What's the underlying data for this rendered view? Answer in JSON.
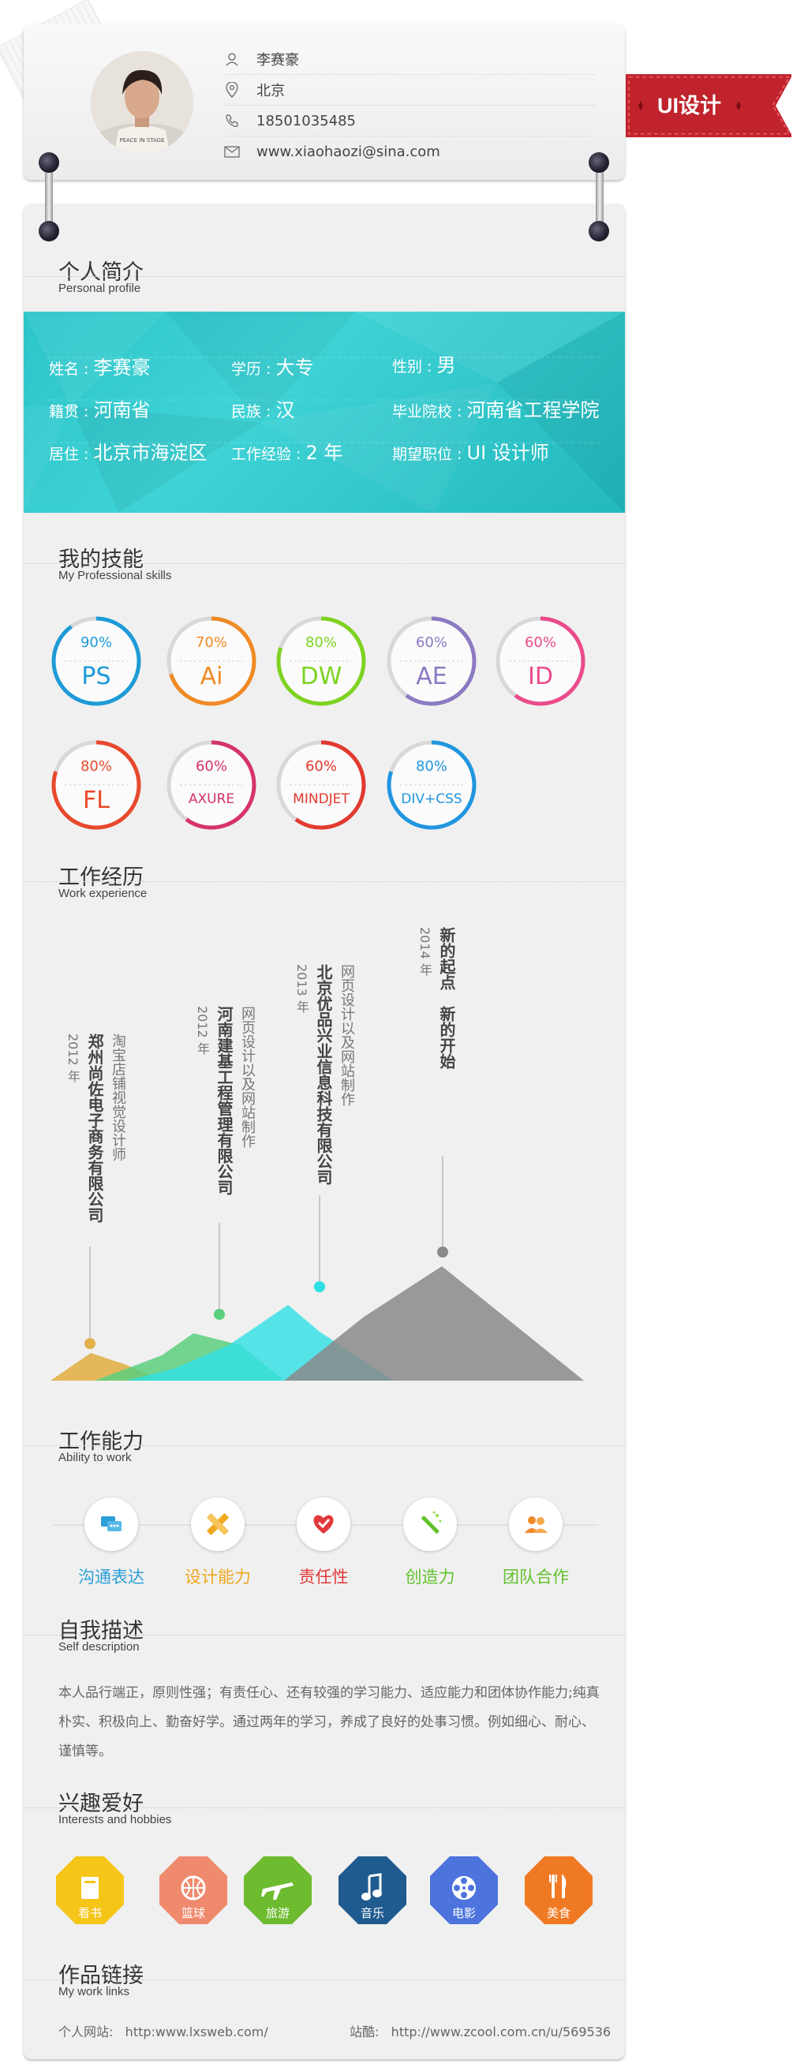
{
  "contact": {
    "name": "李赛豪",
    "city": "北京",
    "phone": "18501035485",
    "email": "www.xiaohaozi@sina.com"
  },
  "ribbon": {
    "label": "UI设计"
  },
  "sections": {
    "profile": {
      "title": "个人简介",
      "subtitle": "Personal profile"
    },
    "skills": {
      "title": "我的技能",
      "subtitle": "My Professional skills"
    },
    "experience": {
      "title": "工作经历",
      "subtitle": "Work experience"
    },
    "ability": {
      "title": "工作能力",
      "subtitle": "Ability to work"
    },
    "self": {
      "title": "自我描述",
      "subtitle": "Self description"
    },
    "hobbies": {
      "title": "兴趣爱好",
      "subtitle": "Interests and hobbies"
    },
    "links": {
      "title": "作品链接",
      "subtitle": "My work links"
    }
  },
  "profile": {
    "name_label": "姓名 :",
    "name_value": "李赛豪",
    "edu_label": "学历 :",
    "edu_value": "大专",
    "gender_label": "性别 :",
    "gender_value": "男",
    "origin_label": "籍贯 :",
    "origin_value": "河南省",
    "ethnic_label": "民族 :",
    "ethnic_value": "汉",
    "school_label": "毕业院校 :",
    "school_value": "河南省工程学院",
    "residence_label": "居住 :",
    "residence_value": "北京市海淀区",
    "years_label": "工作经验 :",
    "years_value": "2 年",
    "position_label": "期望职位 :",
    "position_value": "UI 设计师"
  },
  "skills": [
    {
      "name": "PS",
      "percent": "90%",
      "value": 0.9,
      "color": "#1e9bd7"
    },
    {
      "name": "Ai",
      "percent": "70%",
      "value": 0.7,
      "color": "#f08a24"
    },
    {
      "name": "DW",
      "percent": "80%",
      "value": 0.8,
      "color": "#7ed321"
    },
    {
      "name": "AE",
      "percent": "60%",
      "value": 0.6,
      "color": "#8c7ac3"
    },
    {
      "name": "ID",
      "percent": "60%",
      "value": 0.6,
      "color": "#ea4b8b"
    },
    {
      "name": "FL",
      "percent": "80%",
      "value": 0.8,
      "color": "#e8492c"
    },
    {
      "name": "AXURE",
      "percent": "60%",
      "value": 0.6,
      "color": "#d6336c"
    },
    {
      "name": "MINDJET",
      "percent": "60%",
      "value": 0.6,
      "color": "#e23a2f"
    },
    {
      "name": "DIV+CSS",
      "percent": "80%",
      "value": 0.8,
      "color": "#2196e0"
    }
  ],
  "experience": [
    {
      "year": "2012 年",
      "company": "郑州尚佐电子商务有限公司",
      "role": "淘宝店铺视觉设计师",
      "dot": "#e2b04a"
    },
    {
      "year": "2012 年",
      "company": "河南建基工程管理有限公司",
      "role": "网页设计以及网站制作",
      "dot": "#5ccf7e"
    },
    {
      "year": "2013 年",
      "company": "北京优品兴业信息科技有限公司",
      "role": "网页设计以及网站制作",
      "dot": "#2ee0e6"
    },
    {
      "year": "2014 年",
      "company": "新的起点",
      "role": "新的开始",
      "dot": "#8a8a8a"
    }
  ],
  "abilities": [
    {
      "label": "沟通表达",
      "color": "#2a9fd8",
      "icon": "chat-icon"
    },
    {
      "label": "设计能力",
      "color": "#f0a81e",
      "icon": "pencil-ruler-icon"
    },
    {
      "label": "责任性",
      "color": "#e23a3a",
      "icon": "heart-icon"
    },
    {
      "label": "创造力",
      "color": "#62c22c",
      "icon": "magic-wand-icon"
    },
    {
      "label": "团队合作",
      "color": "#62c22c",
      "icon": "team-icon"
    }
  ],
  "self_description": "本人品行端正，原则性强；有责任心、还有较强的学习能力、适应能力和团体协作能力;纯真朴实、积极向上、勤奋好学。通过两年的学习，养成了良好的处事习惯。例如细心、耐心、谨慎等。",
  "hobbies": [
    {
      "label": "看书",
      "color": "#f5c518",
      "icon": "book-icon"
    },
    {
      "label": "篮球",
      "color": "#ef8a6e",
      "icon": "basketball-icon"
    },
    {
      "label": "旅游",
      "color": "#6dbb2e",
      "icon": "airplane-icon"
    },
    {
      "label": "音乐",
      "color": "#1f5b8f",
      "icon": "music-icon"
    },
    {
      "label": "电影",
      "color": "#4d74dc",
      "icon": "film-reel-icon"
    },
    {
      "label": "美食",
      "color": "#f07a23",
      "icon": "fork-knife-icon"
    }
  ],
  "links": {
    "site_label": "个人网站:",
    "site_url": "http:www.lxsweb.com/",
    "zcool_label": "站酷:",
    "zcool_url": "http://www.zcool.com.cn/u/569536"
  }
}
